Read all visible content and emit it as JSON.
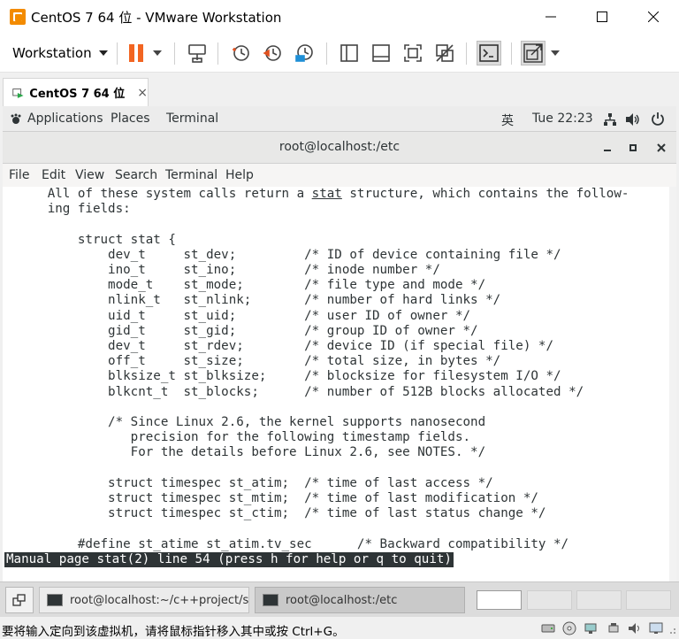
{
  "window": {
    "title": "CentOS 7 64 位 - VMware Workstation"
  },
  "toolbar": {
    "workstation_menu": "Workstation",
    "icons": [
      "pause-icon",
      "send-keys-icon",
      "snapshot-icon",
      "revert-snapshot-icon",
      "snapshot-manager-icon",
      "sidebar-icon",
      "thumbnail-icon",
      "fullscreen-icon",
      "unity-icon",
      "console-icon",
      "stretch-icon"
    ]
  },
  "vm_tab": {
    "label": "CentOS 7 64 位",
    "close": "×"
  },
  "gnome": {
    "applications": "Applications",
    "places": "Places",
    "terminal": "Terminal",
    "input_method": "英",
    "clock": "Tue 22:23"
  },
  "terminal": {
    "title": "root@localhost:/etc",
    "menu": [
      "File",
      "Edit",
      "View",
      "Search",
      "Terminal",
      "Help"
    ],
    "status": "Manual page stat(2) line 54 (press h for help or q to quit)"
  },
  "taskbar": {
    "task1": "root@localhost:~/c++project/soc...",
    "task2": "root@localhost:/etc"
  },
  "statusbar": {
    "text": "要将输入定向到该虚拟机，请将鼠标指针移入其中或按 Ctrl+G。"
  },
  "colors": {
    "pause_orange": "#f26522",
    "terminal_fg": "#2e3436",
    "status_bg": "#2e3436"
  }
}
